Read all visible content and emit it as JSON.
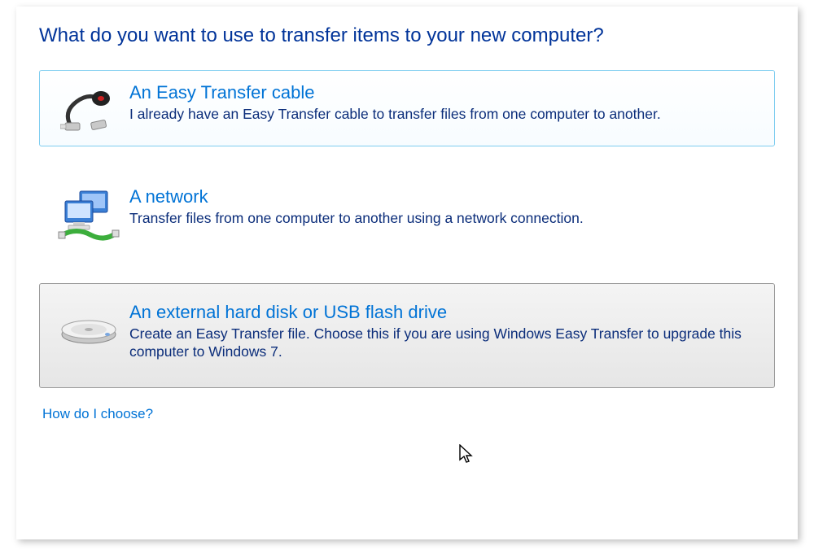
{
  "heading": "What do you want to use to transfer items to your new computer?",
  "options": [
    {
      "title": "An Easy Transfer cable",
      "desc": "I already have an Easy Transfer cable to transfer files from one computer to another."
    },
    {
      "title": "A network",
      "desc": "Transfer files from one computer to another using a network connection."
    },
    {
      "title": "An external hard disk or USB flash drive",
      "desc": "Create an Easy Transfer file. Choose this if you are using Windows Easy Transfer to upgrade this computer to Windows 7."
    }
  ],
  "help_link": "How do I choose?"
}
